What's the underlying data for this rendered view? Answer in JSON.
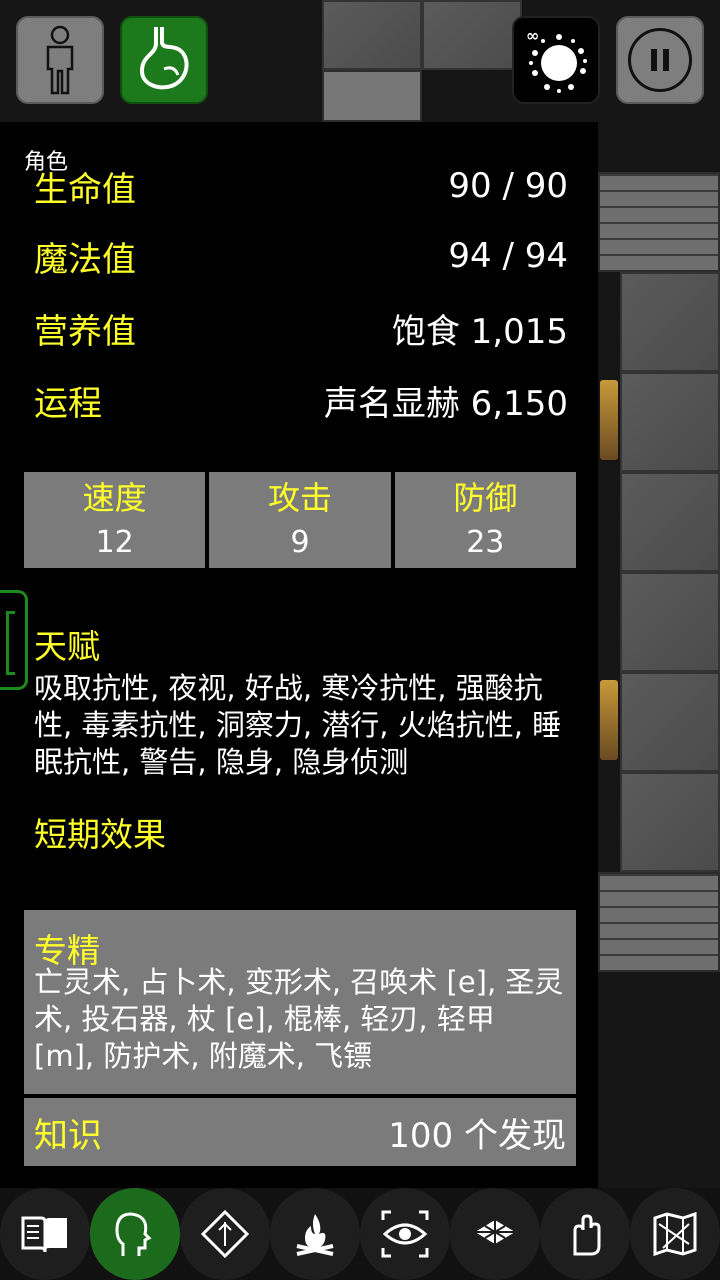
{
  "top_buttons": {
    "character_icon": "person-icon",
    "hunger_icon": "stomach-icon",
    "video_icon": "infinity-burst-icon",
    "video_label": "∞",
    "pause_icon": "pause-icon"
  },
  "panel": {
    "title": "角色",
    "stats": [
      {
        "label": "生命值",
        "value": "90 / 90"
      },
      {
        "label": "魔法值",
        "value": "94 / 94"
      },
      {
        "label": "营养值",
        "value": "饱食 1,015"
      },
      {
        "label": "运程",
        "value": "声名显赫 6,150"
      }
    ],
    "tiles": [
      {
        "label": "速度",
        "value": "12"
      },
      {
        "label": "攻击",
        "value": "9"
      },
      {
        "label": "防御",
        "value": "23"
      }
    ],
    "talents_title": "天赋",
    "talents": "吸取抗性, 夜视, 好战, 寒冷抗性, 强酸抗性, 毒素抗性, 洞察力, 潜行, 火焰抗性, 睡眠抗性, 警告, 隐身, 隐身侦测",
    "effects_title": "短期效果",
    "skills_title": "专精",
    "skills": "亡灵术, 占卜术, 变形术, 召唤术 [e], 圣灵术, 投石器, 杖 [e], 棍棒, 轻刃, 轻甲 [m], 防护术, 附魔术, 飞镖",
    "knowledge_label": "知识",
    "knowledge_value": "100 个发现"
  },
  "toolbar": [
    {
      "icon": "book-icon"
    },
    {
      "icon": "head-icon",
      "active": true
    },
    {
      "icon": "spell-diamond-icon"
    },
    {
      "icon": "campfire-icon"
    },
    {
      "icon": "eye-look-icon"
    },
    {
      "icon": "map-tiles-icon"
    },
    {
      "icon": "hand-icon"
    },
    {
      "icon": "map-icon"
    }
  ],
  "colors": {
    "accent_yellow": "#ffff29",
    "active_green": "#1c6a1c",
    "tile_gray": "#7b7b7b"
  }
}
